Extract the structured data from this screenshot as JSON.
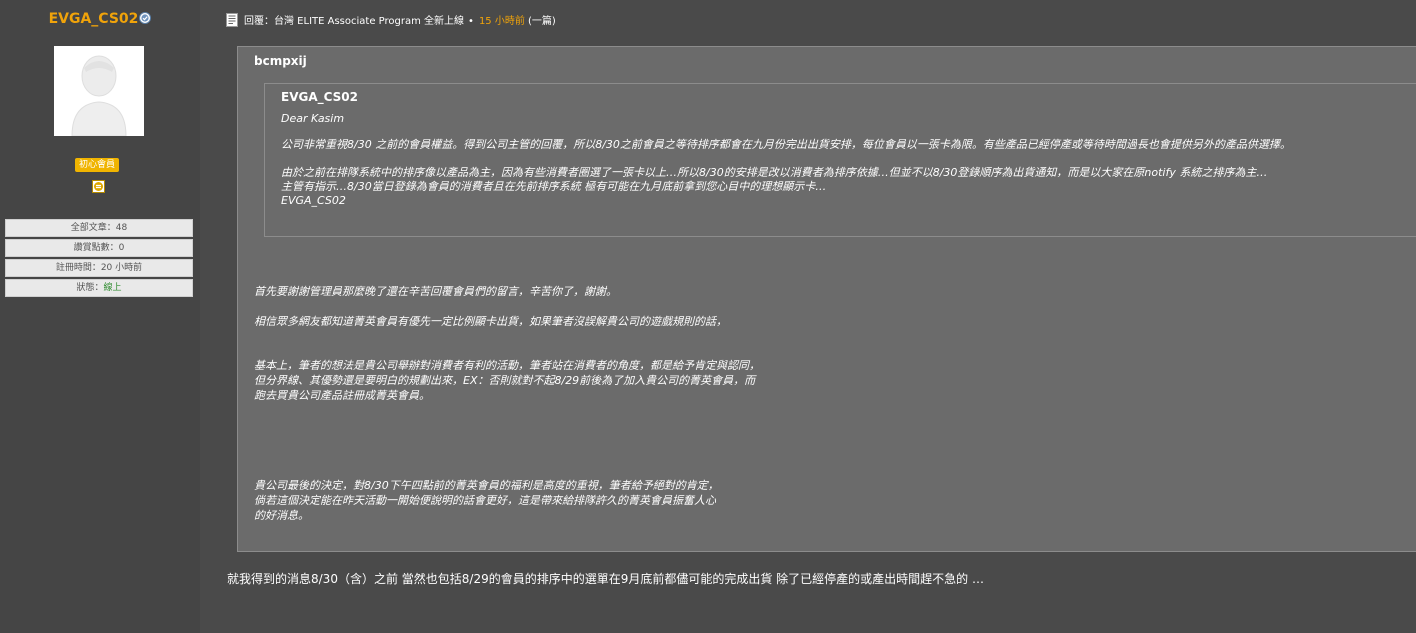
{
  "user": {
    "username": "EVGA_CS02",
    "rank": "初心會員",
    "stats": {
      "posts": "全部文章：48",
      "points": "讚賞點數：0",
      "registered": "註冊時間：20 小時前",
      "status_label": "狀態：",
      "status_value": "線上"
    }
  },
  "post": {
    "reply_prefix": "回覆：",
    "thread_title": "台灣 ELITE Associate Program 全新上線",
    "time": "15 小時前",
    "count": "(一篇)",
    "quote_outer_author": "bcmpxij",
    "quote_inner_author": "EVGA_CS02",
    "quote_inner_lines": [
      "Dear Kasim",
      "公司非常重視8/30 之前的會員權益。得到公司主管的回覆，所以8/30之前會員之等待排序都會在九月份完出出貨安排，每位會員以一張卡為限。有些產品已經停產或等待時間過長也會提供另外的產品供選擇。",
      "由於之前在排隊系統中的排序像以產品為主，因為有些消費者圈選了一張卡以上…所以8/30的安排是改以消費者為排序依據…但並不以8/30登錄順序為出貨通知，而是以大家在原notify 系統之排序為主…",
      "主管有指示…8/30當日登錄為會員的消費者且在先前排序系統 極有可能在九月底前拿到您心目中的理想顯示卡…",
      "EVGA_CS02"
    ],
    "reply_lines": [
      "首先要謝謝管理員那麼晚了還在辛苦回覆會員們的留言，辛苦你了，謝謝。",
      "相信眾多網友都知道菁英會員有優先一定比例顯卡出貨，如果筆者沒誤解貴公司的遊戲規則的話，",
      "基本上，筆者的想法是貴公司舉辦對消費者有利的活動，筆者站在消費者的角度，都是給予肯定與認同，",
      "但分界線、其優勢還是要明白的規劃出來，EX：否則就對不起8/29前後為了加入貴公司的菁英會員，而",
      "跑去買貴公司產品註冊成菁英會員。",
      "貴公司最後的決定，對8/30下午四點前的菁英會員的福利是高度的重視，筆者給予絕對的肯定，",
      "倘若這個決定能在昨天活動一開始便說明的話會更好，這是帶來給排隊許久的菁英會員振奮人心",
      "的好消息。"
    ],
    "body": "就我得到的消息8/30（含）之前 當然也包括8/29的會員的排序中的選單在9月底前都儘可能的完成出貨 除了已經停產的或產出時間趕不急的 …"
  }
}
